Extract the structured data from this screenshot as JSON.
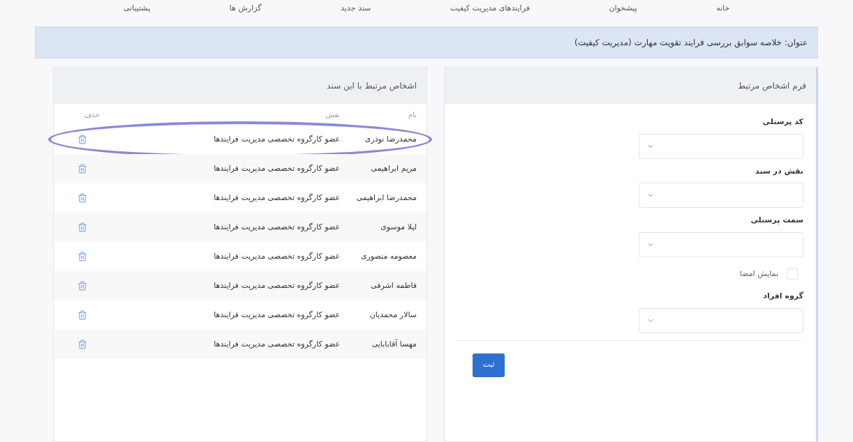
{
  "nav": [
    "خانه",
    "پیشخوان",
    "فرایندهای مدیریت کیفیت",
    "سند جدید",
    "گزارش ها",
    "پشتیبانی"
  ],
  "banner": "عنوان: خلاصه سوابق بررسی فرایند تقویت مهارت (مدیریت کیفیت)",
  "form_panel": {
    "title": "فرم اشخاص مرتبط",
    "fields": [
      {
        "kind": "select",
        "label": "کد پرسنلی"
      },
      {
        "kind": "select",
        "label": "نقش در سند"
      },
      {
        "kind": "select",
        "label": "سمت پرسنلی"
      },
      {
        "kind": "checkbox",
        "label": "نمایش امضا",
        "checked": false
      },
      {
        "kind": "select",
        "label": "گروه افراد"
      }
    ],
    "submit": "ثبت"
  },
  "related_panel": {
    "title": "اشخاص مرتبط با این سند",
    "columns": [
      "نام",
      "نقش",
      "حذف"
    ],
    "rows": [
      {
        "name": "محمدرضا نوذری",
        "role": "عضو کارگروه تخصصی مدیریت فرایندها",
        "circled": true
      },
      {
        "name": "مریم ابراهیمی",
        "role": "عضو کارگروه تخصصی مدیریت فرایندها",
        "circled": false
      },
      {
        "name": "محمدرضا ابراهیمی",
        "role": "عضو کارگروه تخصصی مدیریت فرایندها",
        "circled": false
      },
      {
        "name": "لیلا موسوی",
        "role": "عضو کارگروه تخصصی مدیریت فرایندها",
        "circled": false
      },
      {
        "name": "معصومه منصوری",
        "role": "عضو کارگروه تخصصی مدیریت فرایندها",
        "circled": false
      },
      {
        "name": "فاطمه اشرفی",
        "role": "عضو کارگروه تخصصی مدیریت فرایندها",
        "circled": false
      },
      {
        "name": "سالار محمدیان",
        "role": "عضو کارگروه تخصصی مدیریت فرایندها",
        "circled": false
      },
      {
        "name": "مهسا آقابابایی",
        "role": "عضو کارگروه تخصصی مدیریت فرایندها",
        "circled": false
      }
    ]
  }
}
